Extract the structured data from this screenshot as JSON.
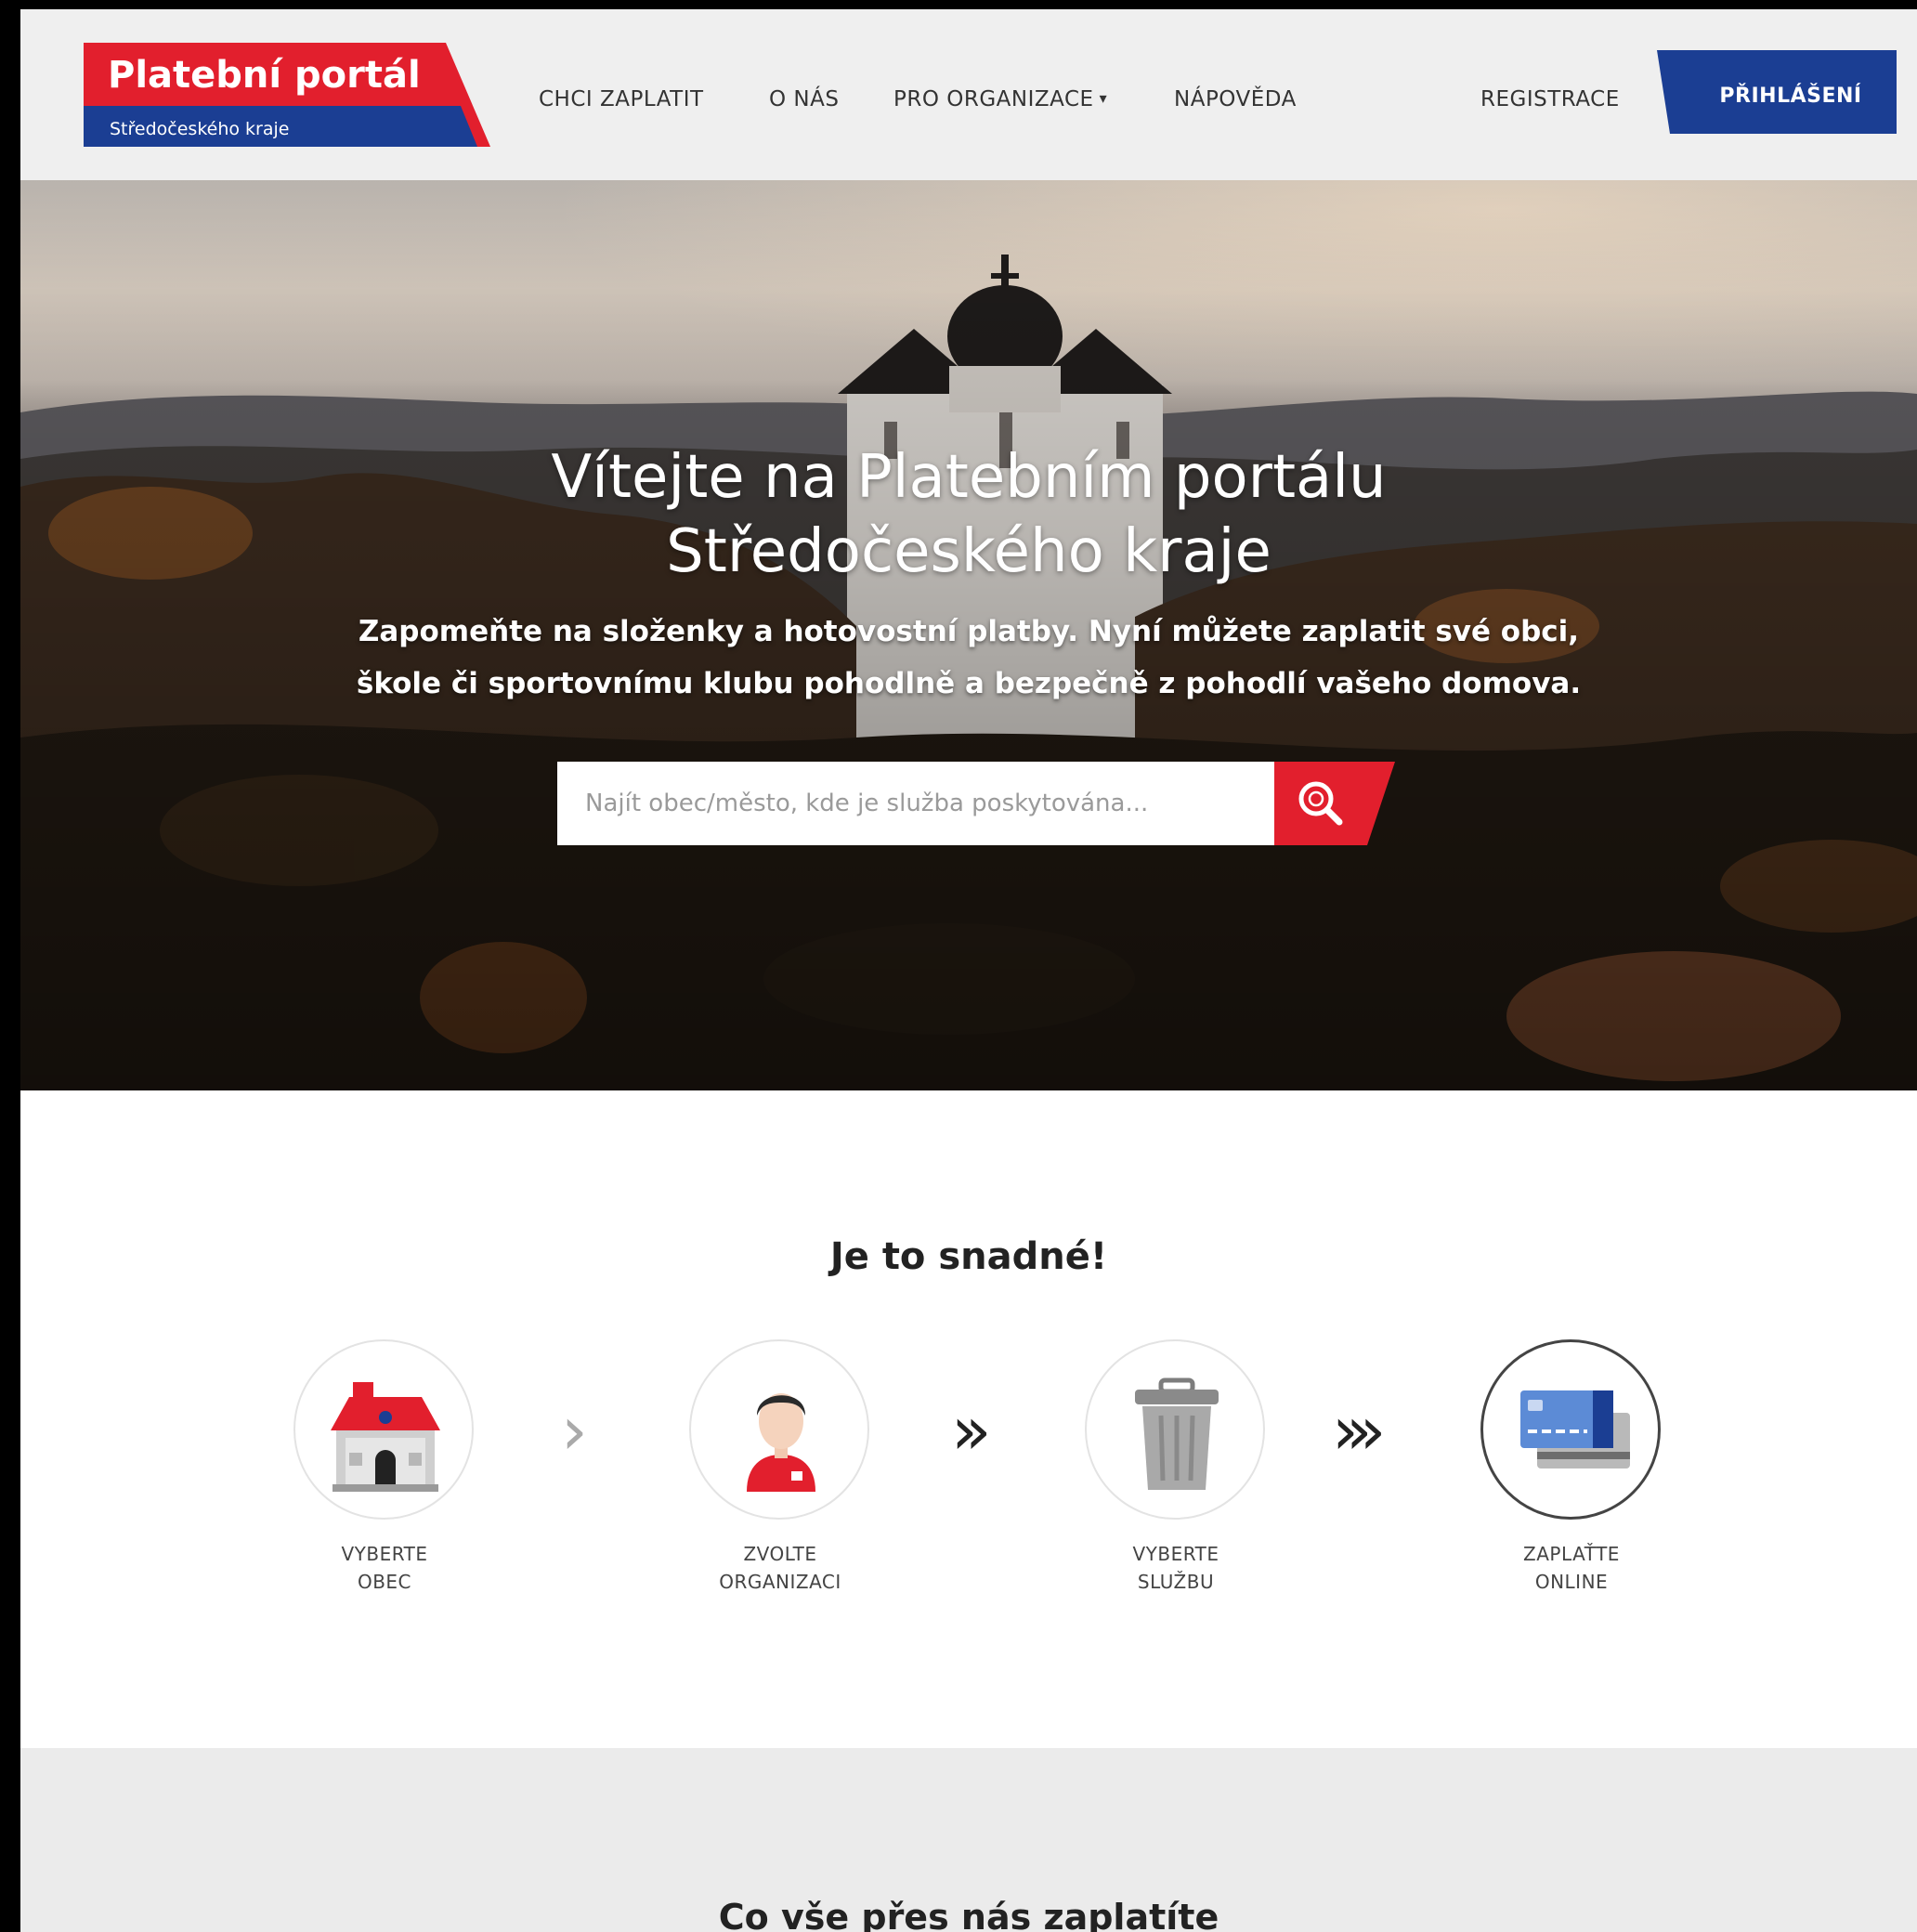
{
  "brand": {
    "title": "Platební portál",
    "subtitle": "Středočeského kraje",
    "red": "#e21f2d",
    "blue": "#1b3e93"
  },
  "nav": {
    "items": [
      "CHCI ZAPLATIT",
      "O NÁS",
      "PRO ORGANIZACE",
      "NÁPOVĚDA"
    ],
    "register": "REGISTRACE",
    "login": "PŘIHLÁŠENÍ"
  },
  "hero": {
    "title_line1": "Vítejte na Platebním portálu",
    "title_line2": "Středočeského kraje",
    "subtitle_line1": "Zapomeňte na složenky a hotovostní platby. Nyní můžete zaplatit své obci,",
    "subtitle_line2": "škole či sportovnímu klubu pohodlně a bezpečně z pohodlí vašeho domova.",
    "search_placeholder": "Najít obec/město, kde je služba poskytována...",
    "search_icon": "magnifier-icon"
  },
  "steps": {
    "title": "Je to snadné!",
    "items": [
      {
        "line1": "VYBERTE",
        "line2": "OBEC",
        "icon": "town-hall-icon"
      },
      {
        "line1": "ZVOLTE",
        "line2": "ORGANIZACI",
        "icon": "person-icon"
      },
      {
        "line1": "VYBERTE",
        "line2": "SLUŽBU",
        "icon": "trash-bin-icon"
      },
      {
        "line1": "ZAPLAŤTE",
        "line2": "ONLINE",
        "icon": "credit-card-icon"
      }
    ],
    "arrows": [
      "›",
      "››",
      "›››"
    ]
  },
  "bottom": {
    "title": "Co vše přes nás zaplatíte"
  }
}
